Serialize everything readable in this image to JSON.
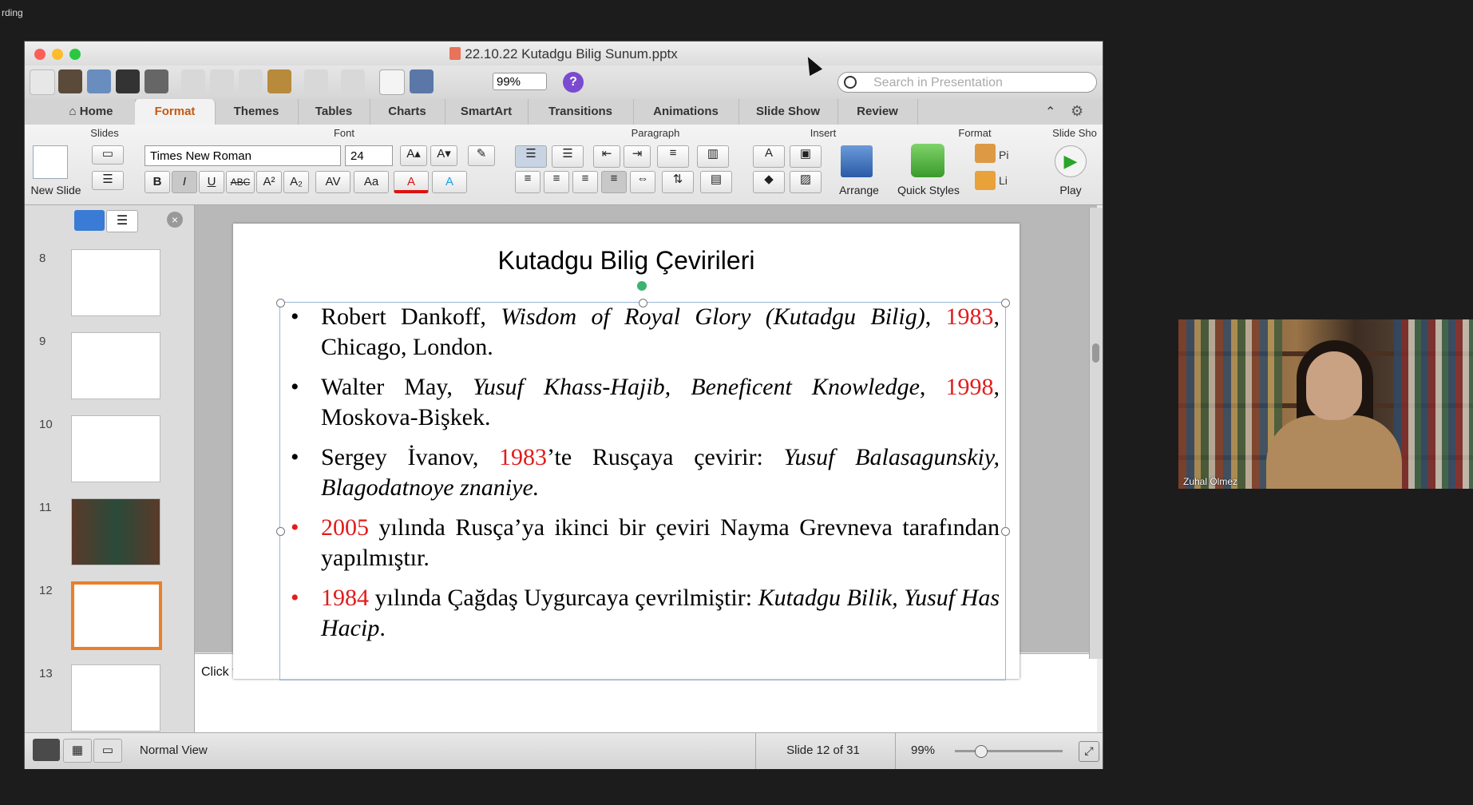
{
  "recording_label": "rding",
  "window": {
    "title": "22.10.22 Kutadgu Bilig Sunum.pptx",
    "zoom": "99%",
    "search_placeholder": "Search in Presentation"
  },
  "tabs": [
    {
      "label": "Home"
    },
    {
      "label": "Format"
    },
    {
      "label": "Themes"
    },
    {
      "label": "Tables"
    },
    {
      "label": "Charts"
    },
    {
      "label": "SmartArt"
    },
    {
      "label": "Transitions"
    },
    {
      "label": "Animations"
    },
    {
      "label": "Slide Show"
    },
    {
      "label": "Review"
    }
  ],
  "active_tab": "Format",
  "ribbon": {
    "groups": [
      "Slides",
      "Font",
      "Paragraph",
      "Insert",
      "Format",
      "Slide Sho"
    ],
    "new_slide": "New Slide",
    "font_name": "Times New Roman",
    "font_size": "24",
    "arrange": "Arrange",
    "quick_styles": "Quick Styles",
    "play": "Play",
    "picture_label": "Pi",
    "line_label": "Li",
    "format_buttons": [
      "B",
      "I",
      "U",
      "ABC",
      "A²",
      "A₂",
      "AV",
      "Aa",
      "A",
      "A"
    ]
  },
  "thumbnails": [
    {
      "num": "8"
    },
    {
      "num": "9"
    },
    {
      "num": "10"
    },
    {
      "num": "11"
    },
    {
      "num": "12"
    },
    {
      "num": "13"
    }
  ],
  "slide": {
    "title": "Kutadgu Bilig Çevirileri",
    "bullets": [
      {
        "a": "Robert Dankoff, ",
        "b": "Wisdom of Royal Glory (Kutadgu Bilig)",
        "c": ", ",
        "d": "1983",
        "e": ", Chicago, London."
      },
      {
        "a": "Walter May, ",
        "b": "Yusuf Khass-Hajib, Beneficent Knowledge",
        "c": ", ",
        "d": "1998",
        "e": ", Moskova-Bişkek."
      },
      {
        "a": "Sergey İvanov, ",
        "d": "1983",
        "e": "’te Rusçaya çevirir: ",
        "b": "Yusuf Balasagunskiy, Blagodatnoye znaniye."
      },
      {
        "d": "2005",
        "e": " yılında Rusça’ya ikinci bir çeviri Nayma Grevneva tarafından yapılmıştır."
      },
      {
        "d": "1984",
        "e": " yılında Çağdaş Uygurcaya çevrilmiştir: ",
        "b": "Kutadgu Bilik, Yusuf Has Hacip",
        "c": "."
      }
    ]
  },
  "notes_placeholder": "Click to add notes",
  "status": {
    "view": "Normal View",
    "slide_pos": "Slide 12 of 31",
    "zoom": "99%"
  },
  "participant": {
    "name": "Zuhal Ölmez"
  }
}
